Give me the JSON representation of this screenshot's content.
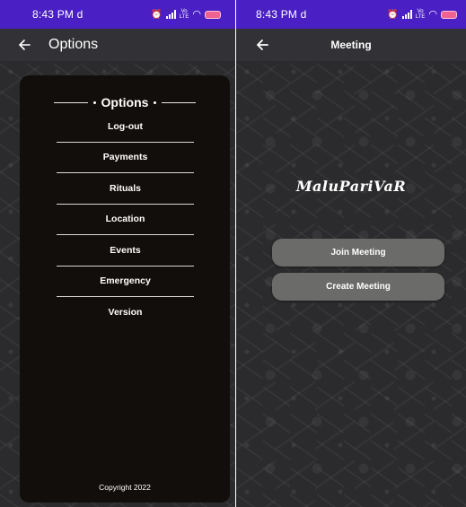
{
  "left_screen": {
    "status_bar": {
      "time": "8:43 PM",
      "carrier_mark": "d",
      "icons": [
        "alarm-icon",
        "signal-icon",
        "volte-icon",
        "wifi-icon",
        "battery-icon"
      ]
    },
    "app_bar": {
      "back_icon": "arrow-left-icon",
      "title": "Options"
    },
    "drawer": {
      "header": "Options",
      "items": [
        {
          "label": "Log-out"
        },
        {
          "label": "Payments"
        },
        {
          "label": "Rituals"
        },
        {
          "label": "Location"
        },
        {
          "label": "Events"
        },
        {
          "label": "Emergency"
        },
        {
          "label": "Version"
        }
      ],
      "footer": "Copyright 2022"
    }
  },
  "right_screen": {
    "status_bar": {
      "time": "8:43 PM",
      "carrier_mark": "d"
    },
    "app_bar": {
      "back_icon": "arrow-left-icon",
      "title": "Meeting"
    },
    "logo": "MaluPariVaR",
    "buttons": {
      "join": "Join Meeting",
      "create": "Create Meeting"
    }
  },
  "colors": {
    "status_bar": "#4a1fc4",
    "app_bar": "#323236",
    "background": "#2b2b2d",
    "drawer": "#120e0b",
    "button": "#6b6b69",
    "battery": "#f06292"
  }
}
